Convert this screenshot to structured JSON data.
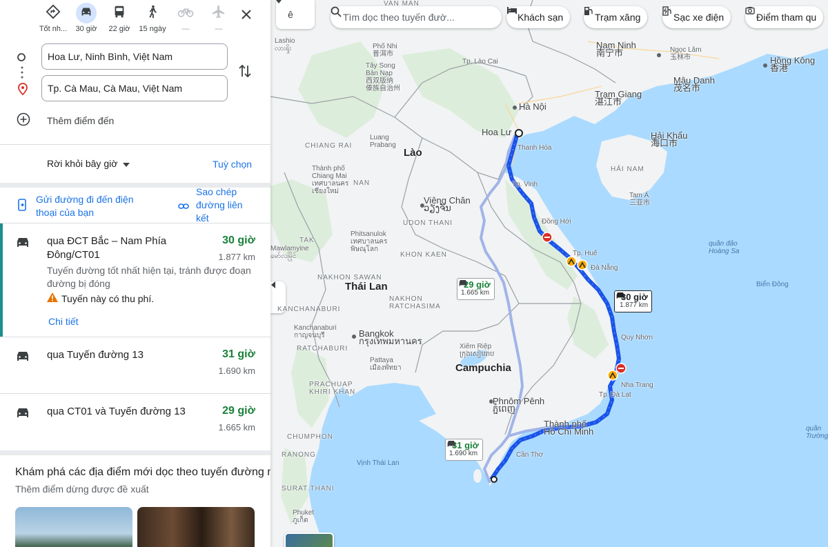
{
  "modes": [
    {
      "label": "Tốt nh...",
      "icon": "best-route-icon"
    },
    {
      "label": "30 giờ",
      "icon": "car-icon"
    },
    {
      "label": "22 giờ",
      "icon": "bus-icon"
    },
    {
      "label": "15 ngày",
      "icon": "walk-icon"
    },
    {
      "label": "—",
      "icon": "bicycle-icon"
    },
    {
      "label": "—",
      "icon": "plane-icon"
    }
  ],
  "origin": "Hoa Lư, Ninh Bình, Việt Nam",
  "destination": "Tp. Cà Mau, Cà Mau, Việt Nam",
  "add_destination": "Thêm điểm đến",
  "depart_label": "Rời khỏi bây giờ",
  "options_label": "Tuỳ chọn",
  "send_to_phone": "Gửi đường đi đến điện thoại của bạn",
  "copy_link": "Sao chép đường liên kết",
  "routes": [
    {
      "name": "qua ĐCT Bắc – Nam Phía Đông/CT01",
      "duration": "30 giờ",
      "distance": "1.877 km",
      "description": "Tuyến đường tốt nhất hiện tại, tránh được đoạn đường bị đóng",
      "warning": "Tuyến này có thu phí.",
      "detail": "Chi tiết"
    },
    {
      "name": "qua Tuyến đường 13",
      "duration": "31 giờ",
      "distance": "1.690 km"
    },
    {
      "name": "qua CT01 và Tuyến đường 13",
      "duration": "29 giờ",
      "distance": "1.665 km"
    }
  ],
  "explore_title": "Khám phá các địa điểm mới dọc theo tuyến đường n",
  "explore_subtitle": "Thêm điểm dừng được đề xuất",
  "map": {
    "search_placeholder": "Tìm dọc theo tuyến đườ...",
    "chips": [
      "Khách sạn",
      "Trạm xăng",
      "Sạc xe điện",
      "Điểm tham qu"
    ],
    "layer_label": "ê",
    "route_boxes": [
      {
        "duration": "30 giờ",
        "distance": "1.877 km"
      },
      {
        "duration": "29 giờ",
        "distance": "1.665 km"
      },
      {
        "duration": "31 giờ",
        "distance": "1.690 km"
      }
    ],
    "labels": {
      "lasio": "Lashio",
      "lasio2": "လားရှိုး",
      "vanman": "VAN MAN",
      "phongtho": "Phố Nhi",
      "phongtho2": "普洱市",
      "taysong": "Tây Song",
      "taysong2": "Bản Nạp",
      "taysong3": "西双版纳",
      "taysong4": "傣族自治州",
      "laocai": "Tp. Lào Cai",
      "namninh": "Nam Ninh",
      "namninh2": "南宁市",
      "ngoclam": "Ngọc Lâm",
      "ngoclam2": "玉林市",
      "hongkong": "Hồng Kông",
      "hongkong2": "香港",
      "maudanh": "Mậu Danh",
      "maudanh2": "茂名市",
      "tramgiang": "Trạm Giang",
      "tramgiang2": "湛江市",
      "hanoi": "Hà Nội",
      "haikhau": "Hải Khẩu",
      "haikhau2": "海口市",
      "hoalu": "Hoa Lư",
      "thanhhoa": "Thanh Hóa",
      "chiangrai": "CHIANG RAI",
      "luang": "Luang",
      "luang2": "Prabang",
      "lao": "Lào",
      "hainam": "HẢI NAM",
      "chiangmai": "Thành phố",
      "chiangmai2": "Chiang Mai",
      "chiangmai3": "เทศบาลนคร",
      "chiangmai4": "เชียงใหม่",
      "nan": "NAN",
      "vinh": "Tp. Vinh",
      "tama": "Tam Á",
      "tama2": "三亚市",
      "vientiane": "Viêng Chăn",
      "vientiane2": "ວຽງຈັນ",
      "udon": "UDON THANI",
      "donghoi": "Đồng Hới",
      "phit": "Phitsanulok",
      "phit2": "เทศบาลนคร",
      "phit3": "พิษณุโลก",
      "tak": "TAK",
      "khonkaen": "KHON KAEN",
      "mawl": "Mawlamyine",
      "mawl2": "မော်လမြိုင်",
      "hue": "Tp. Huế",
      "danang": "Đà Nẵng",
      "hoangsa": "quần đảo",
      "hoangsa2": "Hoàng Sa",
      "nakhon": "NAKHON SAWAN",
      "thailand": "Thái Lan",
      "bienDong": "Biển Đông",
      "nakhonr": "NAKHON",
      "nakhonr2": "RATCHASIMA",
      "kanch": "KANCHANABURI",
      "kanch2": "Kanchanaburi",
      "kanch3": "กาญจนบุรี",
      "bangkok": "Bangkok",
      "bangkok2": "กรุงเทพมหานคร",
      "quinhon": "Quy Nhơn",
      "ratchaburi": "RATCHABURI",
      "siemreap": "Xiêm Riệp",
      "siemreap2": "ក្រុងសៀមរាប",
      "pattaya": "Pattaya",
      "pattaya2": "เมืองพัทยา",
      "campuchia": "Campuchia",
      "nhatrang": "Nha Trang",
      "prachuap": "PRACHUAP",
      "prachuap2": "KHIRI KHAN",
      "dalat": "Tp. Đà Lạt",
      "phnompenh": "Phnôm Pênh",
      "phnompenh2": "ភ្នំពេញ",
      "hcm": "Thành phố",
      "hcm2": "Hồ Chí Minh",
      "chumphon": "CHUMPHON",
      "truongsa": "quần",
      "truongsa2": "Trường S",
      "cantho": "Cần Thơ",
      "ranong": "RANONG",
      "vinhthailan": "Vịnh Thái Lan",
      "suratthani": "SURAT THANI",
      "phuket": "Phuket",
      "phuket2": "ภูเก็ต"
    }
  }
}
